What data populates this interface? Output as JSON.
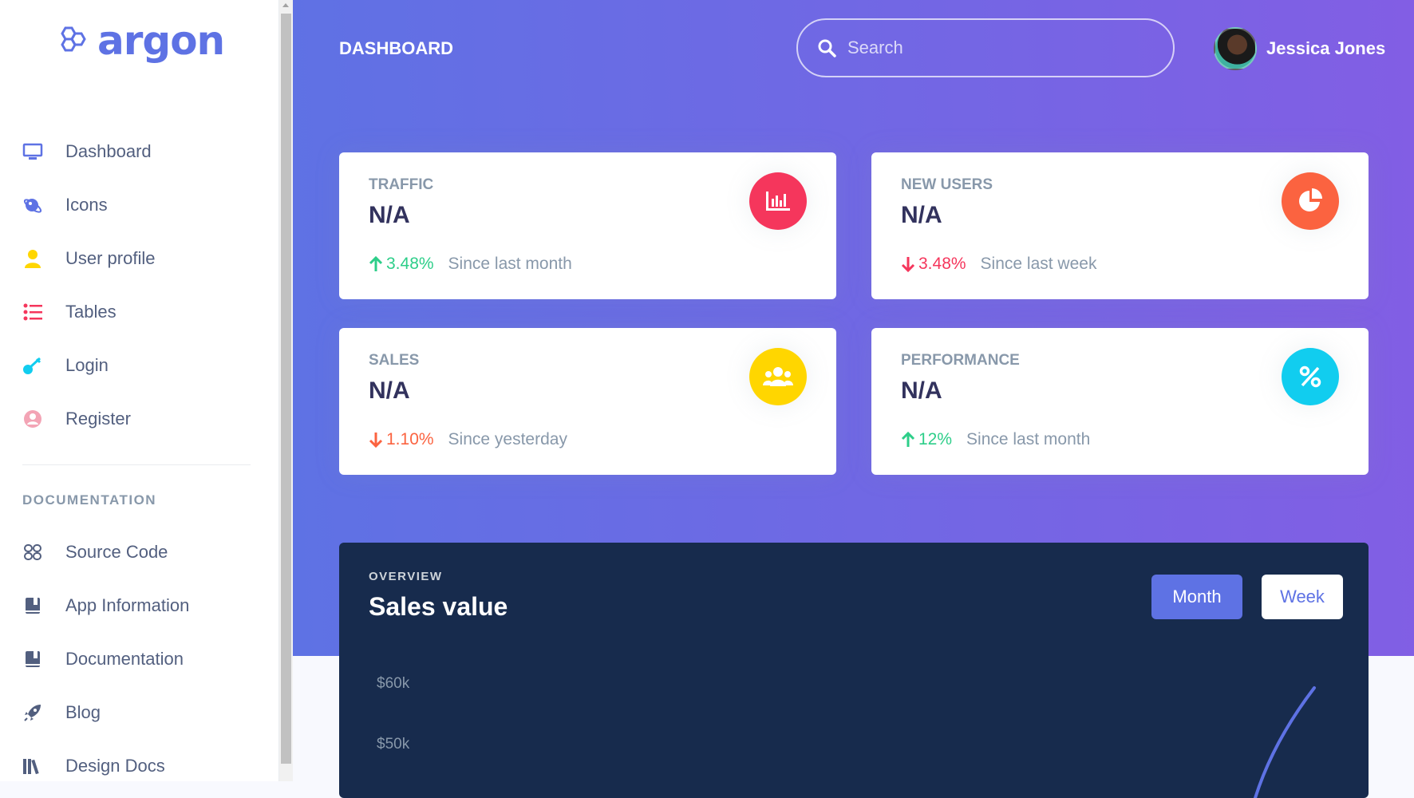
{
  "brand": {
    "name": "argon"
  },
  "sidebar": {
    "items": [
      {
        "label": "Dashboard",
        "icon": "monitor-icon",
        "color": "#5e72e4"
      },
      {
        "label": "Icons",
        "icon": "planet-icon",
        "color": "#5e72e4"
      },
      {
        "label": "User profile",
        "icon": "user-icon",
        "color": "#ffd600"
      },
      {
        "label": "Tables",
        "icon": "list-icon",
        "color": "#f5365c"
      },
      {
        "label": "Login",
        "icon": "key-icon",
        "color": "#11cdef"
      },
      {
        "label": "Register",
        "icon": "user-circle-icon",
        "color": "#f3a4b5"
      }
    ],
    "docs_heading": "DOCUMENTATION",
    "docs": [
      {
        "label": "Source Code",
        "icon": "source-code-icon"
      },
      {
        "label": "App Information",
        "icon": "book-icon"
      },
      {
        "label": "Documentation",
        "icon": "book-icon"
      },
      {
        "label": "Blog",
        "icon": "rocket-icon"
      },
      {
        "label": "Design Docs",
        "icon": "library-icon"
      }
    ]
  },
  "header": {
    "title": "DASHBOARD",
    "search_placeholder": "Search",
    "user_name": "Jessica Jones"
  },
  "stats": [
    {
      "title": "TRAFFIC",
      "value": "N/A",
      "pct": "3.48%",
      "direction": "up",
      "since": "Since last month",
      "icon": "chart-bar-icon",
      "color": "#f5365c"
    },
    {
      "title": "NEW USERS",
      "value": "N/A",
      "pct": "3.48%",
      "direction": "down",
      "since": "Since last week",
      "icon": "chart-pie-icon",
      "color": "#fb6340"
    },
    {
      "title": "SALES",
      "value": "N/A",
      "pct": "1.10%",
      "direction": "down",
      "since": "Since yesterday",
      "icon": "users-icon",
      "color": "#ffd600"
    },
    {
      "title": "PERFORMANCE",
      "value": "N/A",
      "pct": "12%",
      "direction": "up",
      "since": "Since last month",
      "icon": "percent-icon",
      "color": "#11cdef"
    }
  ],
  "overview": {
    "label": "OVERVIEW",
    "title": "Sales value",
    "buttons": {
      "month": "Month",
      "week": "Week"
    }
  },
  "chart_data": {
    "type": "line",
    "title": "Sales value",
    "yticks": [
      "$60k",
      "$50k"
    ],
    "series_color": "#5e72e4"
  }
}
